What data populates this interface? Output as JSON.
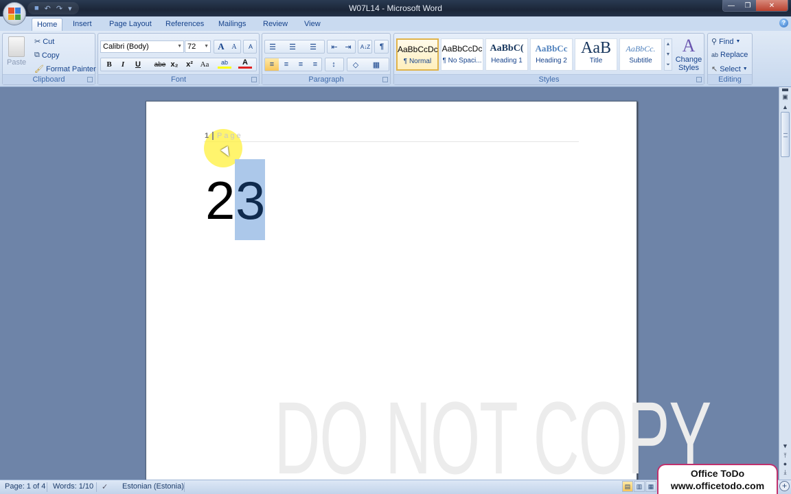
{
  "window": {
    "title": "W07L14 - Microsoft Word",
    "controls": {
      "minimize": "—",
      "restore": "❐",
      "close": "✕"
    }
  },
  "quick_access": {
    "save_icon": "💾",
    "undo_icon": "↶",
    "redo_icon": "↷",
    "customize_icon": "▾"
  },
  "tabs": [
    {
      "label": "Home",
      "active": true
    },
    {
      "label": "Insert"
    },
    {
      "label": "Page Layout"
    },
    {
      "label": "References"
    },
    {
      "label": "Mailings"
    },
    {
      "label": "Review"
    },
    {
      "label": "View"
    }
  ],
  "ribbon": {
    "clipboard": {
      "label": "Clipboard",
      "paste": "Paste",
      "cut": "Cut",
      "copy": "Copy",
      "format_painter": "Format Painter"
    },
    "font": {
      "label": "Font",
      "font_name": "Calibri (Body)",
      "font_size": "72",
      "grow": "A",
      "shrink": "A",
      "clear": "A",
      "bold": "B",
      "italic": "I",
      "underline": "U",
      "strike": "abe",
      "subscript": "x₂",
      "superscript": "x²",
      "change_case": "Aa",
      "highlight": "ab",
      "font_color": "A",
      "highlight_color": "#ffff00",
      "font_color_value": "#e02020"
    },
    "paragraph": {
      "label": "Paragraph",
      "bullets": "☰",
      "numbering": "☰",
      "multilevel": "☰",
      "decrease_indent": "⇤",
      "increase_indent": "⇥",
      "sort": "A↓Z",
      "show_marks": "¶",
      "align_left": "≡",
      "center": "≡",
      "align_right": "≡",
      "justify": "≡",
      "line_spacing": "↕",
      "shading": "◇",
      "borders": "▦"
    },
    "styles": {
      "label": "Styles",
      "items": [
        {
          "preview": "AaBbCcDc",
          "name": "¶ Normal",
          "selected": true
        },
        {
          "preview": "AaBbCcDc",
          "name": "¶ No Spaci..."
        },
        {
          "preview": "AaBbC(",
          "name": "Heading 1"
        },
        {
          "preview": "AaBbCc",
          "name": "Heading 2"
        },
        {
          "preview": "AaB",
          "name": "Title"
        },
        {
          "preview": "AaBbCc.",
          "name": "Subtitle"
        }
      ],
      "change_styles": "Change Styles"
    },
    "editing": {
      "label": "Editing",
      "find": "Find",
      "replace": "Replace",
      "select": "Select"
    }
  },
  "document": {
    "header_page_num": "1",
    "header_page_word": "Page",
    "body_char1": "2",
    "body_char2_selected": "3",
    "watermark": "DO NOT COPY"
  },
  "status": {
    "page": "Page: 1 of 4",
    "words": "Words: 1/10",
    "language": "Estonian (Estonia)",
    "proofing_icon": "✓"
  },
  "badge": {
    "line1": "Office ToDo",
    "line2": "www.officetodo.com"
  }
}
